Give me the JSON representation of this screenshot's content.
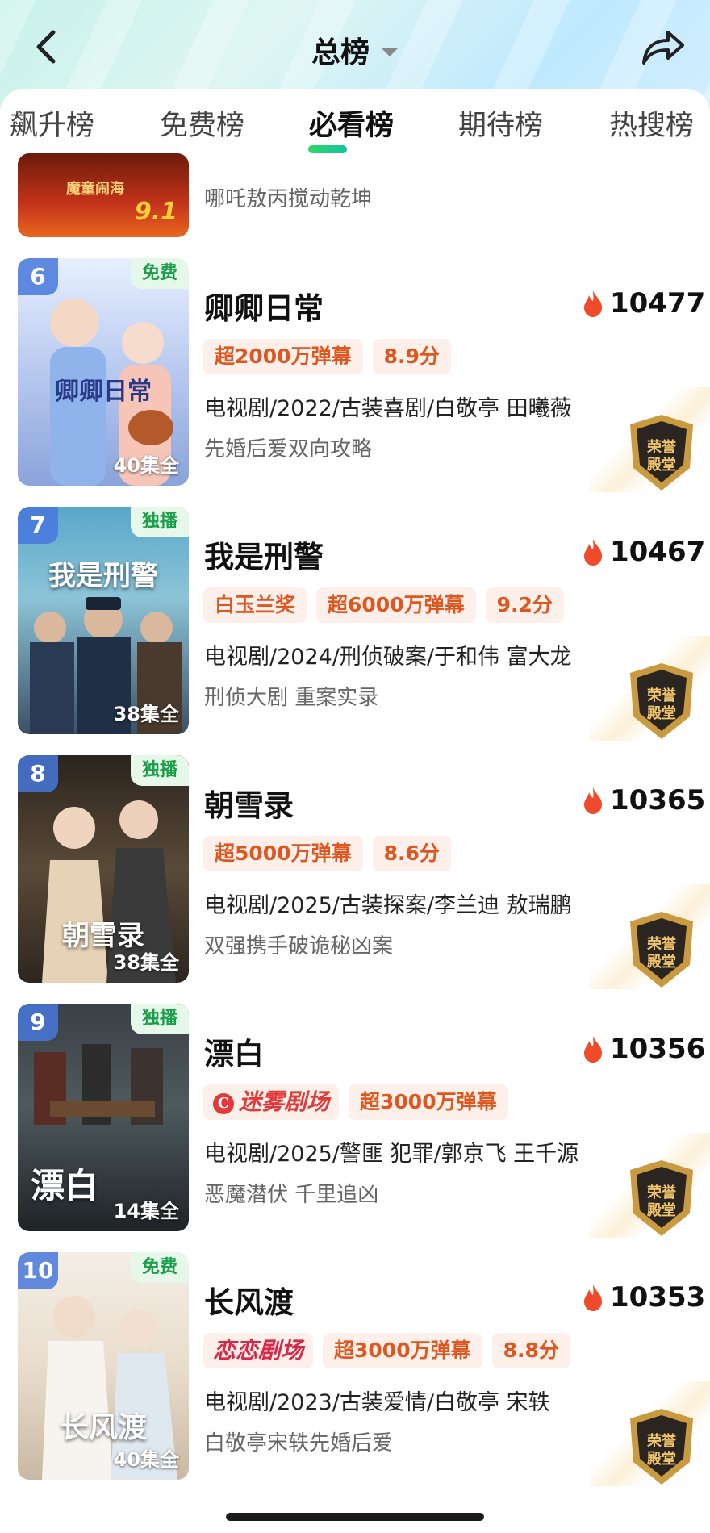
{
  "header": {
    "title": "总榜",
    "back_icon": "chevron-left-icon",
    "share_icon": "share-arrow-icon"
  },
  "tabs": [
    {
      "label": "飙升榜"
    },
    {
      "label": "免费榜"
    },
    {
      "label": "必看榜",
      "active": true
    },
    {
      "label": "期待榜"
    },
    {
      "label": "热搜榜"
    }
  ],
  "partial_item": {
    "poster_score": "9.1",
    "poster_text": "魔童闹海",
    "desc": "哪吒敖丙搅动乾坤"
  },
  "items": [
    {
      "rank": "6",
      "tag": "免费",
      "episodes": "40集全",
      "poster_title": "卿卿日常",
      "name": "卿卿日常",
      "heat": "10477",
      "badges": [
        "超2000万弹幕",
        "8.9分"
      ],
      "info": "电视剧/2022/古装喜剧/白敬亭 田曦薇",
      "desc": "先婚后爱双向攻略",
      "honor": "荣誉殿堂"
    },
    {
      "rank": "7",
      "tag": "独播",
      "episodes": "38集全",
      "poster_title": "我是刑警",
      "name": "我是刑警",
      "heat": "10467",
      "badges": [
        "白玉兰奖",
        "超6000万弹幕",
        "9.2分"
      ],
      "info": "电视剧/2024/刑侦破案/于和伟 富大龙",
      "desc": "刑侦大剧 重案实录",
      "honor": "荣誉殿堂"
    },
    {
      "rank": "8",
      "tag": "独播",
      "episodes": "38集全",
      "poster_title": "朝雪录",
      "name": "朝雪录",
      "heat": "10365",
      "badges": [
        "超5000万弹幕",
        "8.6分"
      ],
      "info": "电视剧/2025/古装探案/李兰迪 敖瑞鹏",
      "desc": "双强携手破诡秘凶案",
      "honor": "荣誉殿堂"
    },
    {
      "rank": "9",
      "tag": "独播",
      "episodes": "14集全",
      "poster_title": "漂白",
      "name": "漂白",
      "heat": "10356",
      "logo": "迷雾剧场",
      "badges": [
        "超3000万弹幕"
      ],
      "info": "电视剧/2025/警匪 犯罪/郭京飞 王千源",
      "desc": "恶魔潜伏 千里追凶",
      "honor": "荣誉殿堂"
    },
    {
      "rank": "10",
      "tag": "免费",
      "episodes": "40集全",
      "poster_title": "长风渡",
      "name": "长风渡",
      "heat": "10353",
      "logo": "恋恋剧场",
      "badges": [
        "超3000万弹幕",
        "8.8分"
      ],
      "info": "电视剧/2023/古装爱情/白敬亭 宋轶",
      "desc": "白敬亭宋轶先婚后爱",
      "honor": "荣誉殿堂"
    }
  ],
  "colors": {
    "accent_green": "#1a9e4a",
    "badge_text": "#e0561f",
    "badge_bg": "#fdf0ea",
    "flame": "#f04a2a",
    "rank_bg": "#4678dc"
  }
}
